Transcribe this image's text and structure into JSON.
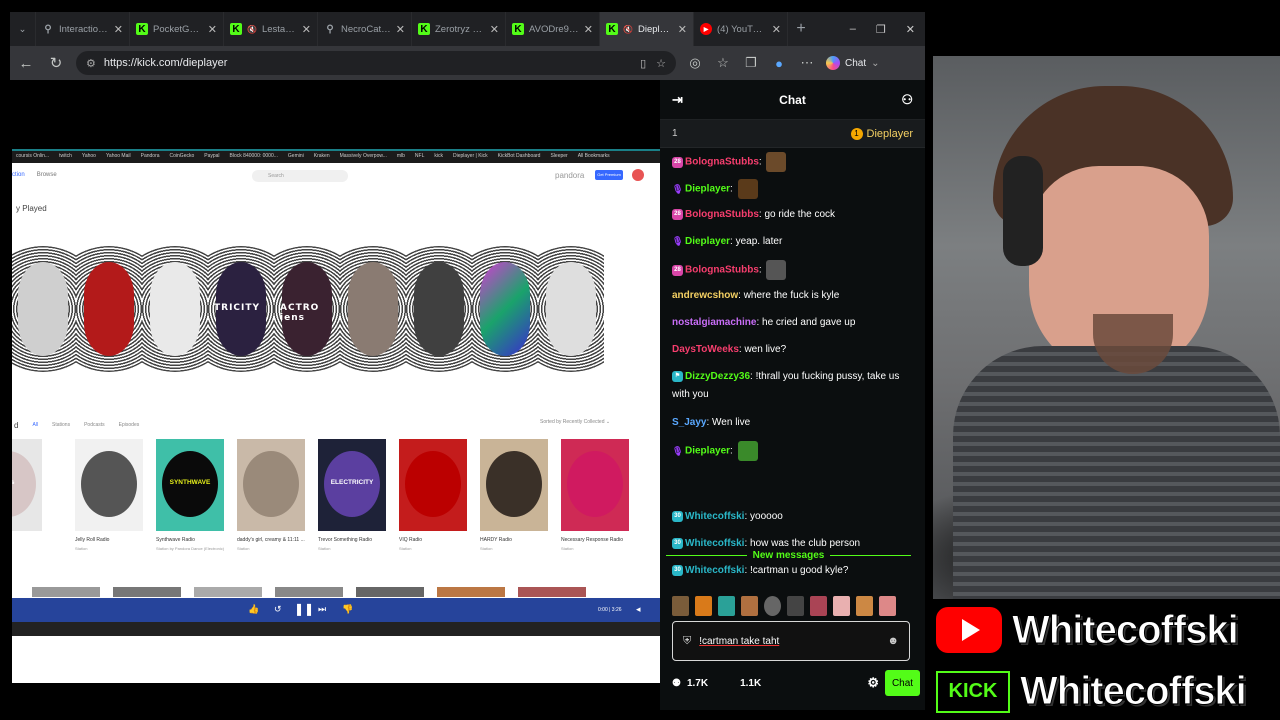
{
  "browser": {
    "tabs": [
      {
        "title": "Interaction | Bot",
        "icon": "pin-icon",
        "active": false
      },
      {
        "title": "PocketGwen Strea",
        "icon": "kick-icon",
        "active": false
      },
      {
        "title": "LestarWOlf St",
        "icon": "kick-icon",
        "active": false,
        "muted": true
      },
      {
        "title": "NecroCaticGam",
        "icon": "pin-icon",
        "active": false
      },
      {
        "title": "Zerotryz Stream",
        "icon": "kick-icon",
        "active": false
      },
      {
        "title": "AVODre999 Strea",
        "icon": "kick-icon",
        "active": false
      },
      {
        "title": "Dieplayer Str",
        "icon": "kick-icon",
        "active": true,
        "muted": true
      },
      {
        "title": "(4) YouTube",
        "icon": "youtube-icon",
        "active": false
      }
    ],
    "new_tab": "+",
    "window_controls": [
      "–",
      "❐",
      "✕"
    ],
    "url": "https://kick.com/dieplayer",
    "chat_label": "Chat"
  },
  "stream_screen": {
    "bookmarks": [
      "coursis Onlin...",
      "twitch",
      "Yahoo",
      "Yahoo Mail",
      "Pandora",
      "CoinGecko",
      "Paypal",
      "Block 840000: 0000...",
      "Gemini",
      "Kraken",
      "Massively Overpow...",
      "mlb",
      "NFL",
      "kick",
      "Dieplayer | Kick",
      "KickBot Dashboard",
      "Sleeper",
      "All Bookmarks"
    ],
    "pandora": {
      "nav_items": [
        "ction",
        "Browse"
      ],
      "search_placeholder": "Search",
      "logo": "pandora",
      "premium": "Get Premium",
      "recently_played": "y Played",
      "cover_captions": [
        "",
        "",
        "",
        "TRICITY",
        "ACTRO iens",
        "",
        "",
        "",
        ""
      ],
      "section_tabs": [
        "d",
        "All",
        "Stations",
        "Podcasts",
        "Episodes"
      ],
      "sort": "Sorted by Recently Collected ⌄",
      "tiles": [
        {
          "name": "",
          "sub": "",
          "label": "iens"
        },
        {
          "name": "Jelly Roll Radio",
          "sub": "Station",
          "label": ""
        },
        {
          "name": "Synthwave Radio",
          "sub": "Station by Pandora Dance (Electronic)",
          "label": "SYNTHWAVE"
        },
        {
          "name": "daddy's girl, creamy & 11:11 ...",
          "sub": "Station",
          "label": ""
        },
        {
          "name": "Trevor Something Radio",
          "sub": "Station",
          "label": "ELECTRICITY"
        },
        {
          "name": "VIQ Radio",
          "sub": "Station",
          "label": ""
        },
        {
          "name": "HARDY Radio",
          "sub": "Station",
          "label": ""
        },
        {
          "name": "Necessary Response Radio",
          "sub": "Station",
          "label": ""
        }
      ],
      "player_time": "0:00 | 3:26"
    }
  },
  "chat": {
    "title": "Chat",
    "pinned_count": "1",
    "pinned_user": "Dieplayer",
    "pinned_badge": "1",
    "messages": [
      {
        "badge": "28",
        "user": "BolognaStubbs",
        "text": "",
        "emote": "emote-1",
        "user_color": "#f73e6e",
        "badge_color": "#d946a8"
      },
      {
        "badge": "mic",
        "user": "Dieplayer",
        "text": "",
        "emote": "emote-2",
        "user_color": "#53fc18",
        "badge_color": "#9b3dff"
      },
      {
        "badge": "28",
        "user": "BolognaStubbs",
        "text": "go ride the cock",
        "emote": "",
        "user_color": "#f73e6e",
        "badge_color": "#d946a8"
      },
      {
        "badge": "mic",
        "user": "Dieplayer",
        "text": "yeap. later",
        "emote": "",
        "user_color": "#53fc18",
        "badge_color": "#9b3dff"
      },
      {
        "badge": "28",
        "user": "BolognaStubbs",
        "text": "",
        "emote": "emote-skull",
        "user_color": "#f73e6e",
        "badge_color": "#d946a8"
      },
      {
        "badge": "",
        "user": "andrewcshow",
        "text": "where the fuck is kyle",
        "emote": "",
        "user_color": "#f4d063",
        "badge_color": ""
      },
      {
        "badge": "",
        "user": "nostalgiamachine",
        "text": "he cried and gave up",
        "emote": "",
        "user_color": "#c86df7",
        "badge_color": ""
      },
      {
        "badge": "",
        "user": "DaysToWeeks",
        "text": "wen live?",
        "emote": "",
        "user_color": "#f73e6e",
        "badge_color": ""
      },
      {
        "badge": "gift",
        "user": "DizzyDezzy36",
        "text": "!thrall you fucking pussy, take us with you",
        "emote": "",
        "user_color": "#53fc18",
        "badge_color": "#2ab7c8"
      },
      {
        "badge": "",
        "user": "S_Jayy",
        "text": "Wen live",
        "emote": "",
        "user_color": "#5aa8ff",
        "badge_color": ""
      },
      {
        "badge": "mic",
        "user": "Dieplayer",
        "text": "",
        "emote": "emote-pepe",
        "user_color": "#53fc18",
        "badge_color": "#9b3dff"
      }
    ],
    "new_messages_label": "New messages",
    "new_messages": [
      {
        "badge": "30",
        "user": "Whitecoffski",
        "text": "yooooo",
        "user_color": "#2ab7c8",
        "badge_color": "#2ab7c8"
      },
      {
        "badge": "30",
        "user": "Whitecoffski",
        "text": "how was the club person",
        "user_color": "#2ab7c8",
        "badge_color": "#2ab7c8"
      },
      {
        "badge": "30",
        "user": "Whitecoffski",
        "text": "!cartman u good kyle?",
        "user_color": "#2ab7c8",
        "badge_color": "#2ab7c8"
      }
    ],
    "input_value": "!cartman take taht",
    "viewers": "1.7K",
    "followers": "1.1K",
    "send_label": "Chat"
  },
  "overlay": {
    "youtube_name": "Whitecoffski",
    "kick_logo": "KICK",
    "kick_name": "Whitecoffski"
  },
  "colors": {
    "kick_green": "#53fc18",
    "youtube_red": "#ff0000",
    "pandora_blue": "#26449b"
  }
}
